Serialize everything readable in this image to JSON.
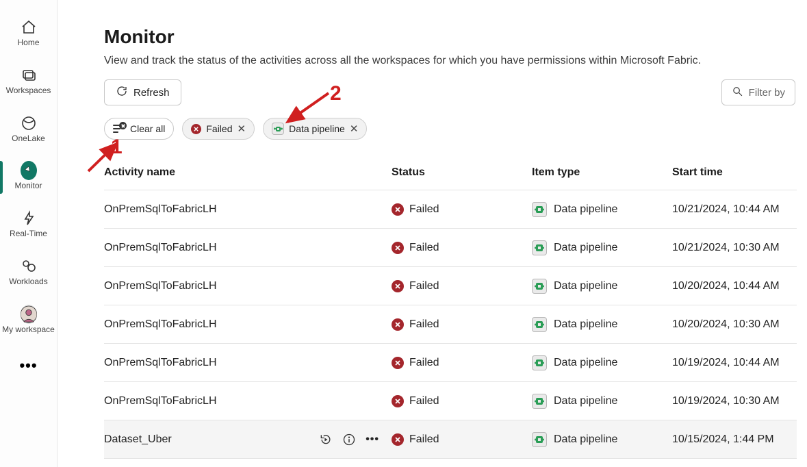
{
  "sidebar": {
    "items": [
      {
        "key": "home",
        "label": "Home"
      },
      {
        "key": "workspaces",
        "label": "Workspaces"
      },
      {
        "key": "onelake",
        "label": "OneLake"
      },
      {
        "key": "monitor",
        "label": "Monitor"
      },
      {
        "key": "realtime",
        "label": "Real-Time"
      },
      {
        "key": "workloads",
        "label": "Workloads"
      },
      {
        "key": "myworkspace",
        "label": "My workspace"
      }
    ]
  },
  "header": {
    "title": "Monitor",
    "subtitle": "View and track the status of the activities across all the workspaces for which you have permissions within Microsoft Fabric."
  },
  "toolbar": {
    "refresh_label": "Refresh",
    "search_placeholder": "Filter by"
  },
  "filters": {
    "clear_all_label": "Clear all",
    "chips": [
      {
        "key": "failed",
        "label": "Failed",
        "icon": "fail"
      },
      {
        "key": "data_pipeline",
        "label": "Data pipeline",
        "icon": "pipeline"
      }
    ]
  },
  "table": {
    "columns": {
      "name": "Activity name",
      "status": "Status",
      "item_type": "Item type",
      "start_time": "Start time"
    },
    "rows": [
      {
        "name": "OnPremSqlToFabricLH",
        "status": "Failed",
        "item_type": "Data pipeline",
        "start_time": "10/21/2024, 10:44 AM"
      },
      {
        "name": "OnPremSqlToFabricLH",
        "status": "Failed",
        "item_type": "Data pipeline",
        "start_time": "10/21/2024, 10:30 AM"
      },
      {
        "name": "OnPremSqlToFabricLH",
        "status": "Failed",
        "item_type": "Data pipeline",
        "start_time": "10/20/2024, 10:44 AM"
      },
      {
        "name": "OnPremSqlToFabricLH",
        "status": "Failed",
        "item_type": "Data pipeline",
        "start_time": "10/20/2024, 10:30 AM"
      },
      {
        "name": "OnPremSqlToFabricLH",
        "status": "Failed",
        "item_type": "Data pipeline",
        "start_time": "10/19/2024, 10:44 AM"
      },
      {
        "name": "OnPremSqlToFabricLH",
        "status": "Failed",
        "item_type": "Data pipeline",
        "start_time": "10/19/2024, 10:30 AM"
      },
      {
        "name": "Dataset_Uber",
        "status": "Failed",
        "item_type": "Data pipeline",
        "start_time": "10/15/2024, 1:44 PM",
        "hovered": true
      }
    ]
  },
  "annotations": {
    "n1": "1",
    "n2": "2"
  }
}
